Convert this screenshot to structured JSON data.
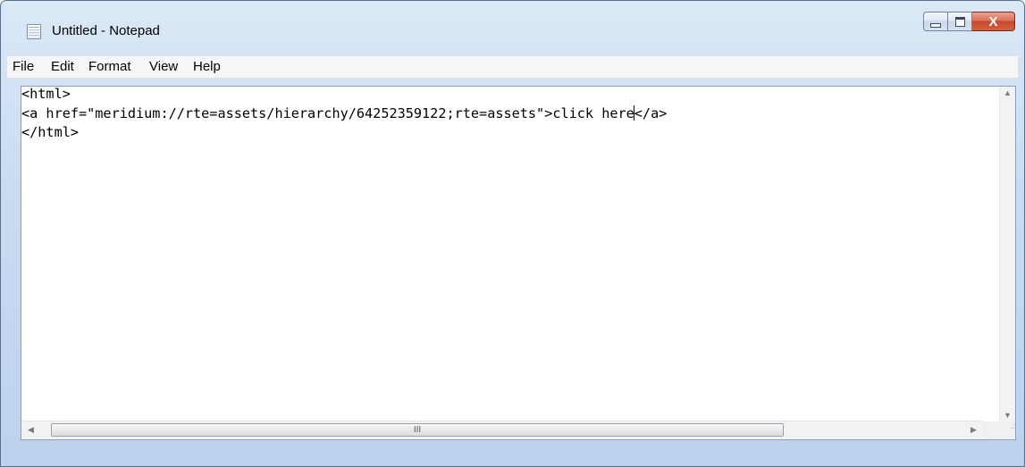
{
  "window": {
    "title": "Untitled - Notepad",
    "icon": "notepad-icon",
    "controls": {
      "minimize_icon": "minimize-icon",
      "maximize_icon": "maximize-icon",
      "close_icon": "close-icon",
      "close_glyph": "X"
    }
  },
  "menu": {
    "file": "File",
    "edit": "Edit",
    "format": "Format",
    "view": "View",
    "help": "Help"
  },
  "editor": {
    "line1": "<html>",
    "line2_before_caret": "<a href=\"meridium://rte=assets/hierarchy/64252359122;rte=assets\">click here",
    "line2_after_caret": "</a>",
    "line3": "</html>"
  },
  "scrollbars": {
    "up_arrow": "▲",
    "down_arrow": "▼",
    "left_arrow": "◀",
    "right_arrow": "▶",
    "thumb_grip": "III",
    "size_grip": ".:"
  },
  "colors": {
    "frame": "#c9dcf1",
    "close_button": "#c4482b",
    "menubar": "#f5f6f7"
  }
}
